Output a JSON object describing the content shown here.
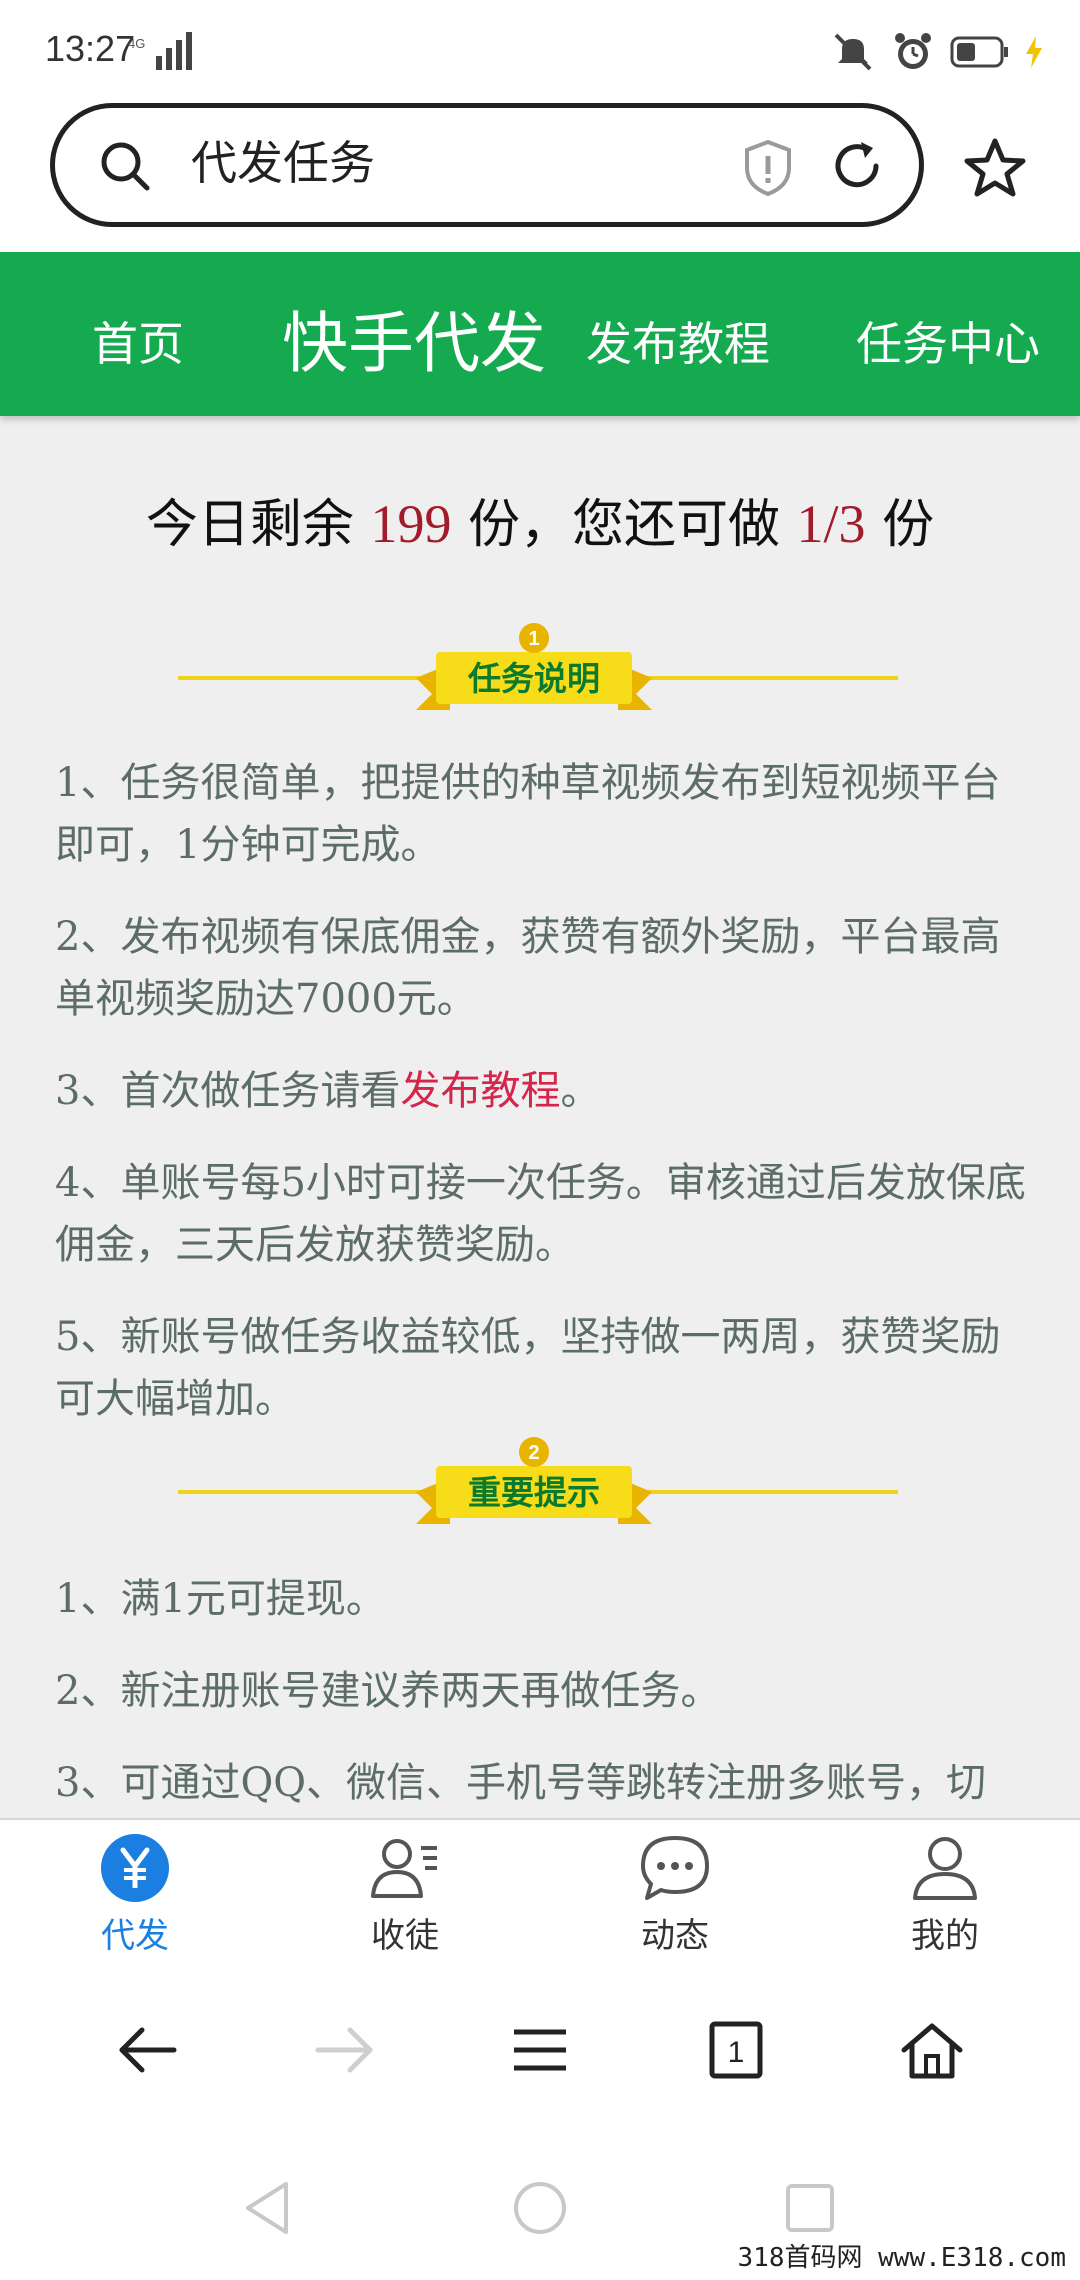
{
  "status": {
    "time": "13:27",
    "network": "4G"
  },
  "addressbar": {
    "query": "代发任务"
  },
  "nav": {
    "home": "首页",
    "brand": "快手代发",
    "tutorial": "发布教程",
    "task_center": "任务中心"
  },
  "remain": {
    "prefix": "今日剩余",
    "count": "199",
    "mid": "份，您还可做",
    "ratio": "1/3",
    "suffix": "份"
  },
  "section1": {
    "badge_number": "1",
    "title": "任务说明",
    "items": [
      "1、任务很简单，把提供的种草视频发布到短视频平台即可，1分钟可完成。",
      "2、发布视频有保底佣金，获赞有额外奖励，平台最高单视频奖励达7000元。",
      "3、首次做任务请看",
      "4、单账号每5小时可接一次任务。审核通过后发放保底佣金，三天后发放获赞奖励。",
      "5、新账号做任务收益较低，坚持做一两周，获赞奖励可大幅增加。"
    ],
    "item3_link": "发布教程",
    "item3_end": "。"
  },
  "section2": {
    "badge_number": "2",
    "title": "重要提示",
    "items": [
      "1、满1元可提现。",
      "2、新注册账号建议养两天再做任务。",
      "3、可通过QQ、微信、手机号等跳转注册多账号，切"
    ]
  },
  "tabs": [
    {
      "label": "代发",
      "icon": "yuan-icon",
      "active": true
    },
    {
      "label": "收徒",
      "icon": "contacts-icon",
      "active": false
    },
    {
      "label": "动态",
      "icon": "chat-bubble-icon",
      "active": false
    },
    {
      "label": "我的",
      "icon": "user-icon",
      "active": false
    }
  ],
  "browser": {
    "tab_count": "1"
  },
  "watermark": "318首码网 www.E318.com",
  "colors": {
    "nav_green": "#16aa50",
    "highlight_red": "#a11b2b",
    "link_red": "#d4254a",
    "tab_active": "#1a7fe0",
    "ribbon_yellow": "#f5d21a"
  }
}
